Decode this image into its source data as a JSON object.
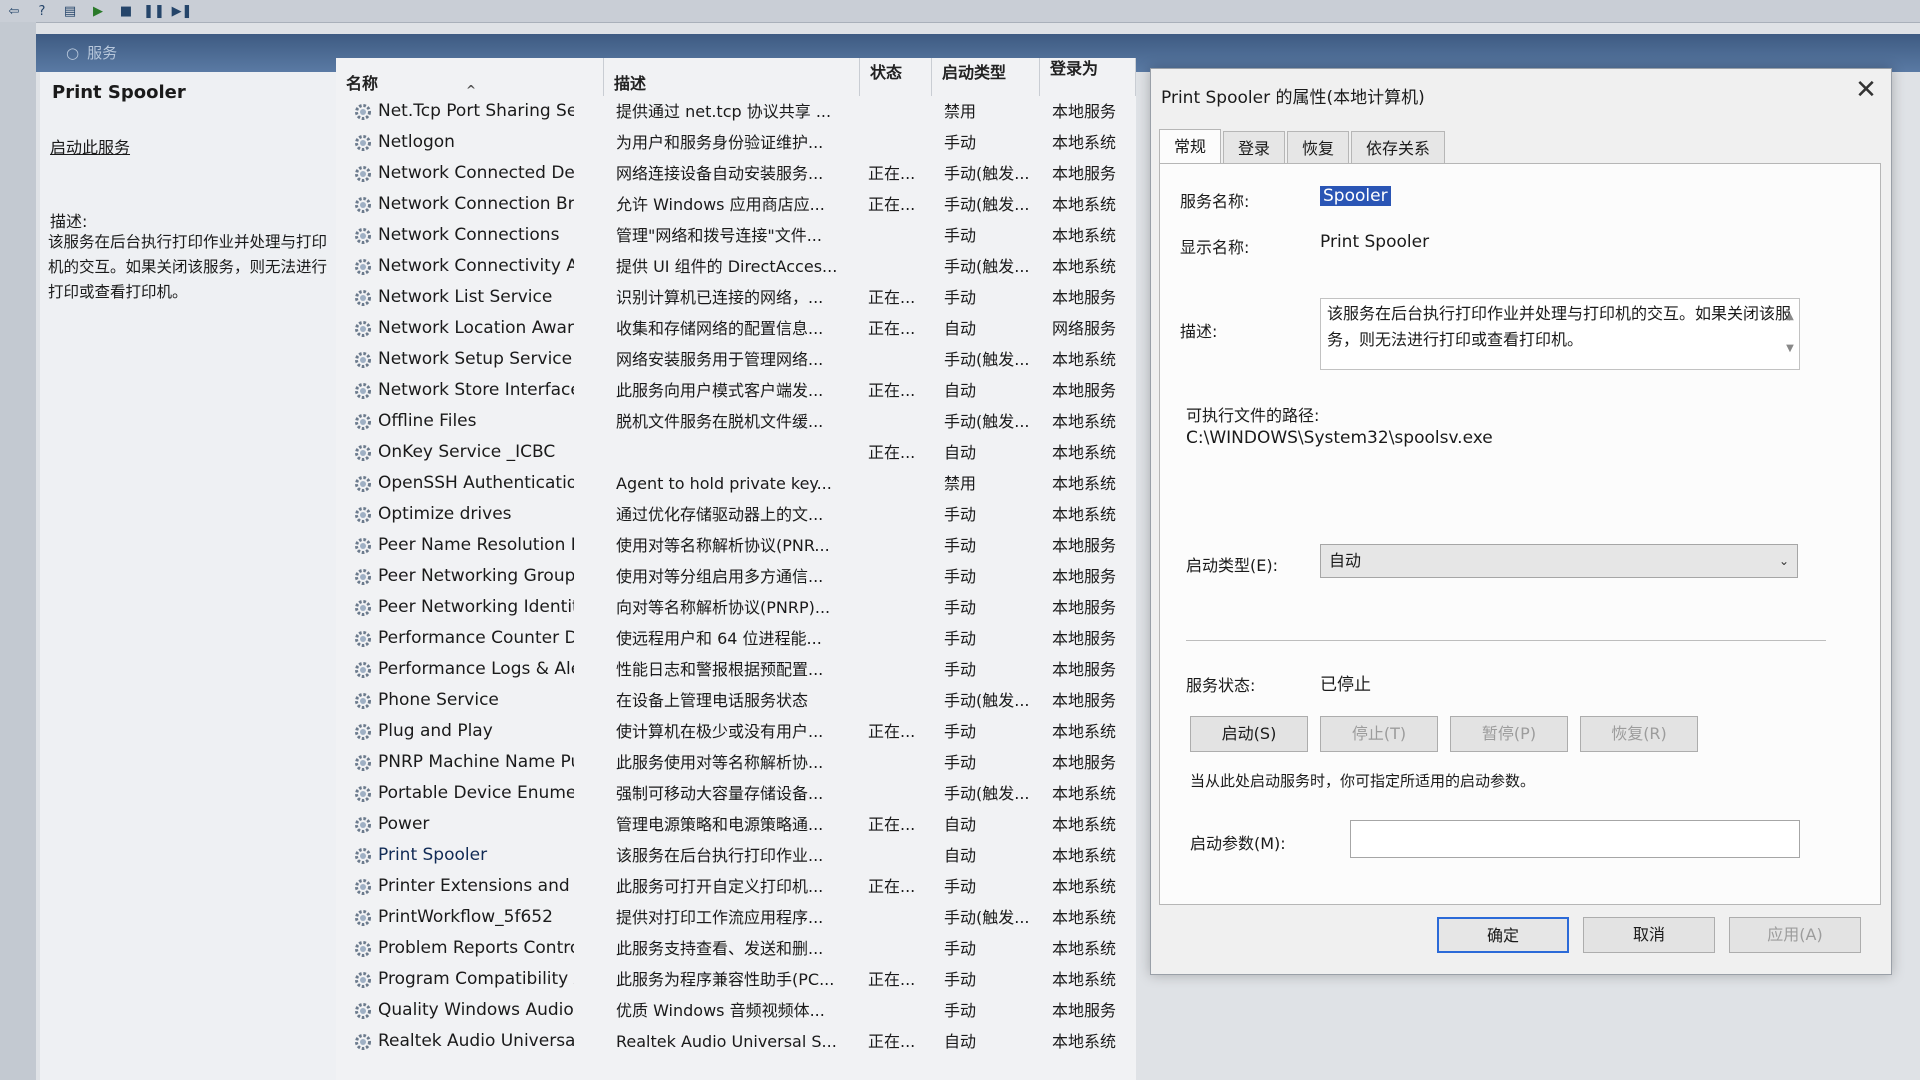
{
  "toolbar": {
    "icons": [
      "back-icon",
      "help-icon",
      "properties-icon",
      "play-icon",
      "stop-icon",
      "pause-icon",
      "resume-icon"
    ]
  },
  "header": {
    "search_label": "服务"
  },
  "left_pane": {
    "title": "Print Spooler",
    "start_link": "启动此服务",
    "desc_label": "描述:",
    "desc_text": "该服务在后台执行打印作业并处理与打印机的交互。如果关闭该服务，则无法进行打印或查看打印机。"
  },
  "columns": {
    "name": "名称",
    "desc": "描述",
    "status": "状态",
    "startup": "启动类型",
    "logon": "登录为"
  },
  "rows": [
    {
      "name": "Net.Tcp Port Sharing Ser...",
      "desc": "提供通过 net.tcp 协议共享 ...",
      "status": "",
      "startup": "禁用",
      "logon": "本地服务"
    },
    {
      "name": "Netlogon",
      "desc": "为用户和服务身份验证维护...",
      "status": "",
      "startup": "手动",
      "logon": "本地系统"
    },
    {
      "name": "Network Connected Devi...",
      "desc": "网络连接设备自动安装服务...",
      "status": "正在...",
      "startup": "手动(触发...",
      "logon": "本地服务"
    },
    {
      "name": "Network Connection Bro...",
      "desc": "允许 Windows 应用商店应...",
      "status": "正在...",
      "startup": "手动(触发...",
      "logon": "本地系统"
    },
    {
      "name": "Network Connections",
      "desc": "管理\"网络和拨号连接\"文件...",
      "status": "",
      "startup": "手动",
      "logon": "本地系统"
    },
    {
      "name": "Network Connectivity Ass...",
      "desc": "提供 UI 组件的 DirectAcces...",
      "status": "",
      "startup": "手动(触发...",
      "logon": "本地系统"
    },
    {
      "name": "Network List Service",
      "desc": "识别计算机已连接的网络，...",
      "status": "正在...",
      "startup": "手动",
      "logon": "本地服务"
    },
    {
      "name": "Network Location Aware...",
      "desc": "收集和存储网络的配置信息...",
      "status": "正在...",
      "startup": "自动",
      "logon": "网络服务"
    },
    {
      "name": "Network Setup Service",
      "desc": "网络安装服务用于管理网络...",
      "status": "",
      "startup": "手动(触发...",
      "logon": "本地系统"
    },
    {
      "name": "Network Store Interface ...",
      "desc": "此服务向用户模式客户端发...",
      "status": "正在...",
      "startup": "自动",
      "logon": "本地服务"
    },
    {
      "name": "Offline Files",
      "desc": "脱机文件服务在脱机文件缓...",
      "status": "",
      "startup": "手动(触发...",
      "logon": "本地系统"
    },
    {
      "name": "OnKey Service _ICBC",
      "desc": "",
      "status": "正在...",
      "startup": "自动",
      "logon": "本地系统"
    },
    {
      "name": "OpenSSH Authentication ...",
      "desc": "Agent to hold private key...",
      "status": "",
      "startup": "禁用",
      "logon": "本地系统"
    },
    {
      "name": "Optimize drives",
      "desc": "通过优化存储驱动器上的文...",
      "status": "",
      "startup": "手动",
      "logon": "本地系统"
    },
    {
      "name": "Peer Name Resolution Pr...",
      "desc": "使用对等名称解析协议(PNR...",
      "status": "",
      "startup": "手动",
      "logon": "本地服务"
    },
    {
      "name": "Peer Networking Groupi...",
      "desc": "使用对等分组启用多方通信...",
      "status": "",
      "startup": "手动",
      "logon": "本地服务"
    },
    {
      "name": "Peer Networking Identity...",
      "desc": "向对等名称解析协议(PNRP)...",
      "status": "",
      "startup": "手动",
      "logon": "本地服务"
    },
    {
      "name": "Performance Counter DL...",
      "desc": "使远程用户和 64 位进程能...",
      "status": "",
      "startup": "手动",
      "logon": "本地服务"
    },
    {
      "name": "Performance Logs & Aler...",
      "desc": "性能日志和警报根据预配置...",
      "status": "",
      "startup": "手动",
      "logon": "本地服务"
    },
    {
      "name": "Phone Service",
      "desc": "在设备上管理电话服务状态",
      "status": "",
      "startup": "手动(触发...",
      "logon": "本地服务"
    },
    {
      "name": "Plug and Play",
      "desc": "使计算机在极少或没有用户...",
      "status": "正在...",
      "startup": "手动",
      "logon": "本地系统"
    },
    {
      "name": "PNRP Machine Name Pu...",
      "desc": "此服务使用对等名称解析协...",
      "status": "",
      "startup": "手动",
      "logon": "本地服务"
    },
    {
      "name": "Portable Device Enumera...",
      "desc": "强制可移动大容量存储设备...",
      "status": "",
      "startup": "手动(触发...",
      "logon": "本地系统"
    },
    {
      "name": "Power",
      "desc": "管理电源策略和电源策略通...",
      "status": "正在...",
      "startup": "自动",
      "logon": "本地系统"
    },
    {
      "name": "Print Spooler",
      "desc": "该服务在后台执行打印作业...",
      "status": "",
      "startup": "自动",
      "logon": "本地系统"
    },
    {
      "name": "Printer Extensions and N...",
      "desc": "此服务可打开自定义打印机...",
      "status": "正在...",
      "startup": "手动",
      "logon": "本地系统"
    },
    {
      "name": "PrintWorkflow_5f652",
      "desc": "提供对打印工作流应用程序...",
      "status": "",
      "startup": "手动(触发...",
      "logon": "本地系统"
    },
    {
      "name": "Problem Reports Control...",
      "desc": "此服务支持查看、发送和删...",
      "status": "",
      "startup": "手动",
      "logon": "本地系统"
    },
    {
      "name": "Program Compatibility A...",
      "desc": "此服务为程序兼容性助手(PC...",
      "status": "正在...",
      "startup": "手动",
      "logon": "本地系统"
    },
    {
      "name": "Quality Windows Audio V...",
      "desc": "优质 Windows 音频视频体...",
      "status": "",
      "startup": "手动",
      "logon": "本地服务"
    },
    {
      "name": "Realtek Audio Universal ...",
      "desc": "Realtek Audio Universal S...",
      "status": "正在...",
      "startup": "自动",
      "logon": "本地系统"
    }
  ],
  "dialog": {
    "title": "Print Spooler 的属性(本地计算机)",
    "tabs": [
      "常规",
      "登录",
      "恢复",
      "依存关系"
    ],
    "service_name_label": "服务名称:",
    "service_name": "Spooler",
    "display_name_label": "显示名称:",
    "display_name": "Print Spooler",
    "desc_label": "描述:",
    "desc_text": "该服务在后台执行打印作业并处理与打印机的交互。如果关闭该服务，则无法进行打印或查看打印机。",
    "path_label": "可执行文件的路径:",
    "path": "C:\\WINDOWS\\System32\\spoolsv.exe",
    "startup_type_label": "启动类型(E):",
    "startup_type": "自动",
    "status_label": "服务状态:",
    "status": "已停止",
    "btn_start": "启动(S)",
    "btn_stop": "停止(T)",
    "btn_pause": "暂停(P)",
    "btn_resume": "恢复(R)",
    "hint": "当从此处启动服务时，你可指定所适用的启动参数。",
    "param_label": "启动参数(M):",
    "param_value": "",
    "btn_ok": "确定",
    "btn_cancel": "取消",
    "btn_apply": "应用(A)"
  },
  "colors": {
    "header": "#4a6890",
    "selection": "#2a55b5",
    "primary_border": "#2b6ad8"
  }
}
